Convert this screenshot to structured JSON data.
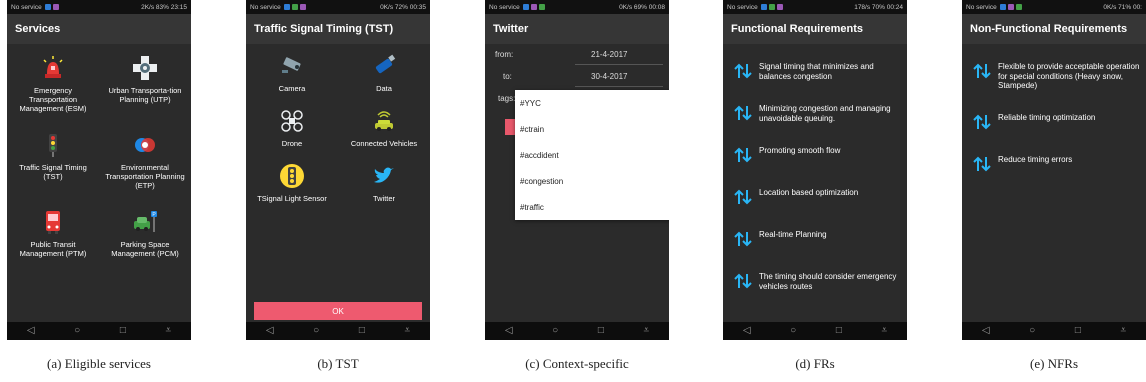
{
  "panels": {
    "a": {
      "status_left": "No service",
      "status_right": "2K/s   83%   23:15",
      "title": "Services",
      "items": [
        {
          "label": "Emergency Transportation Management (ESM)",
          "icon": "siren-icon"
        },
        {
          "label": "Urban Transporta-tion Planning (UTP)",
          "icon": "road-junction-icon"
        },
        {
          "label": "Traffic Signal Timing (TST)",
          "icon": "traffic-light-icon"
        },
        {
          "label": "Environmental Transportation Planning (ETP)",
          "icon": "environment-icon"
        },
        {
          "label": "Public Transit Management (PTM)",
          "icon": "bus-icon"
        },
        {
          "label": "Parking Space Management (PCM)",
          "icon": "parking-car-icon"
        }
      ],
      "caption": "(a) Eligible services"
    },
    "b": {
      "status_left": "No service",
      "status_right": "0K/s   72%   00:35",
      "title": "Traffic Signal Timing (TST)",
      "items": [
        {
          "label": "Camera",
          "icon": "camera-icon"
        },
        {
          "label": "Data",
          "icon": "usb-drive-icon"
        },
        {
          "label": "Drone",
          "icon": "drone-icon"
        },
        {
          "label": "Connected Vehicles",
          "icon": "connected-car-icon"
        },
        {
          "label": "TSignal Light Sensor",
          "icon": "signal-light-icon"
        },
        {
          "label": "Twitter",
          "icon": "twitter-bird-icon"
        }
      ],
      "ok_label": "OK",
      "caption": "(b) TST"
    },
    "c": {
      "status_left": "No service",
      "status_right": "0K/s   69%   00:08",
      "title": "Twitter",
      "from_label": "from:",
      "from_value": "21-4-2017",
      "to_label": "to:",
      "to_value": "30-4-2017",
      "tags_label": "tags:",
      "tags": [
        "#YYC",
        "#ctrain",
        "#accdident",
        "#congestion",
        "#traffic"
      ],
      "caption": "(c) Context-specific"
    },
    "d": {
      "status_left": "No service",
      "status_right": "178/s   70%   00:24",
      "title": "Functional Requirements",
      "items": [
        "Signal timing that minimizes and balances congestion",
        "Minimizing congestion and managing unavoidable queuing.",
        "Promoting smooth flow",
        "Location based optimization",
        "Real-time Planning",
        "The timing should consider emergency vehicles routes"
      ],
      "caption": "(d) FRs"
    },
    "e": {
      "status_left": "No service",
      "status_right": "0K/s   71%   00:",
      "title": "Non-Functional Requirements",
      "items": [
        "Flexible to provide acceptable operation for special conditions (Heavy snow, Stampede)",
        "Reliable timing optimization",
        "Reduce timing errors"
      ],
      "caption": "(e) NFRs"
    }
  },
  "nav": {
    "back": "◁",
    "home": "○",
    "recent": "□",
    "menu": "⩡"
  },
  "colors": {
    "accent": "#ee5a6f",
    "arrow": "#29b6f6",
    "background": "#2b2b2b"
  }
}
